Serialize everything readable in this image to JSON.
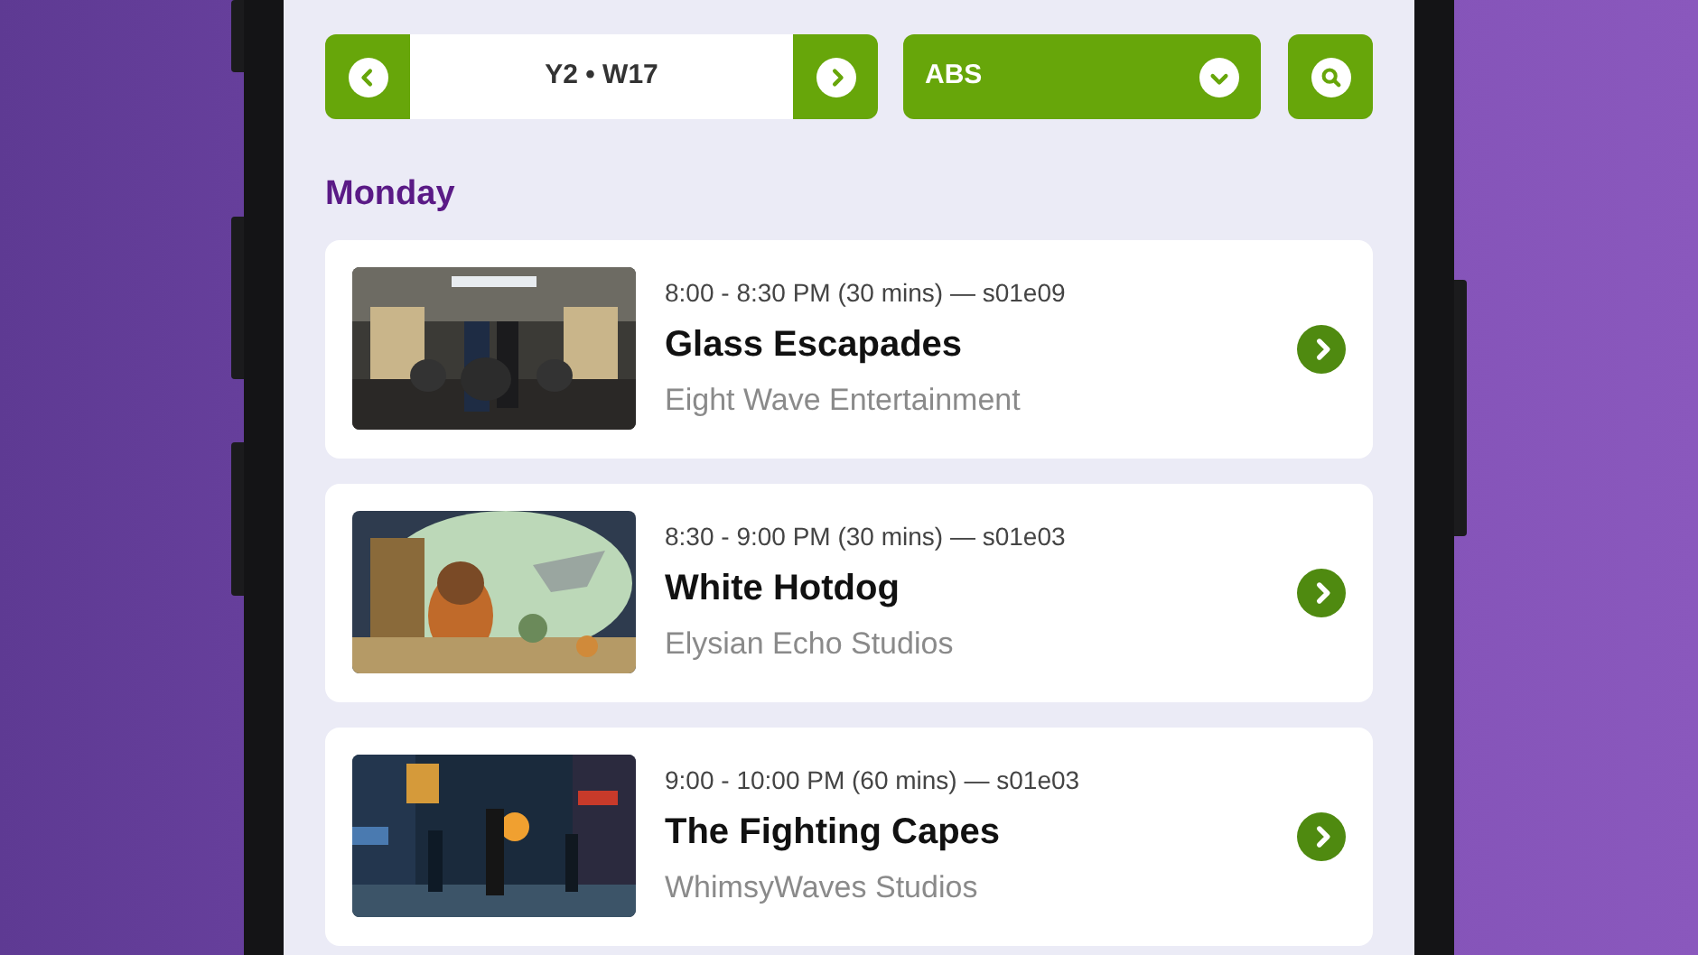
{
  "week_nav": {
    "label": "Y2 • W17"
  },
  "channel_select": {
    "value": "ABS"
  },
  "day": "Monday",
  "shows": [
    {
      "kind": "picture",
      "time": "8:00 - 8:30 PM (30 mins) — s01e09",
      "title": "Glass Escapades",
      "studio": "Eight Wave Entertainment"
    },
    {
      "kind": "picture",
      "time": "8:30 - 9:00 PM (30 mins) — s01e03",
      "title": "White Hotdog",
      "studio": "Elysian Echo Studios"
    },
    {
      "kind": "picture",
      "time": "9:00 - 10:00 PM (60 mins) — s01e03",
      "title": "The Fighting Capes",
      "studio": "WhimsyWaves Studios"
    }
  ]
}
